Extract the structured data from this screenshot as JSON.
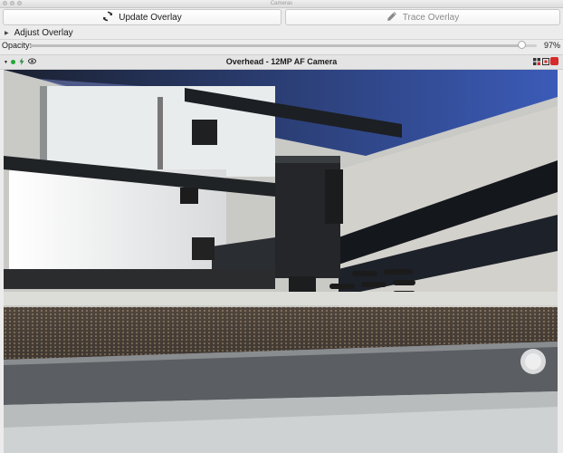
{
  "window": {
    "title": "Cameras"
  },
  "toolbar": {
    "update_overlay_label": "Update Overlay",
    "trace_overlay_label": "Trace Overlay"
  },
  "adjust_overlay": {
    "label": "Adjust Overlay",
    "expanded": false
  },
  "opacity": {
    "label": "Opacity:",
    "value_text": "97%",
    "value": 0.97
  },
  "camera": {
    "title": "Overhead - 12MP AF Camera",
    "status_color": "#22aa33",
    "icons": [
      "collapse-triangle-icon",
      "live-status-icon",
      "flash-icon",
      "eye-icon",
      "grid-icon",
      "focus-icon",
      "record-icon"
    ]
  },
  "colors": {
    "accent_record": "#d42a2a",
    "background": "#ececec"
  }
}
